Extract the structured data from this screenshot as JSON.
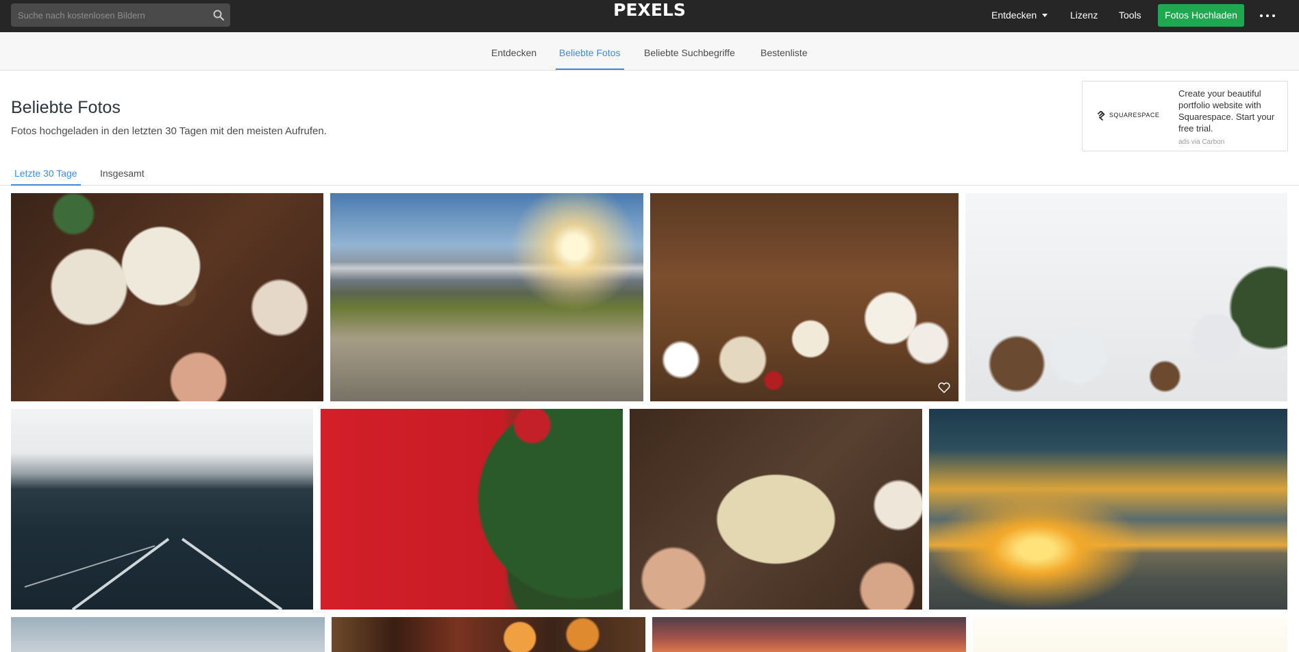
{
  "header": {
    "search_placeholder": "Suche nach kostenlosen Bildern",
    "search_icon": "search-icon",
    "logo": "PEXELS",
    "nav": {
      "discover": "Entdecken",
      "license": "Lizenz",
      "tools": "Tools",
      "upload": "Fotos Hochladen",
      "more_icon": "more-dots-icon"
    }
  },
  "subnav": {
    "items": [
      "Entdecken",
      "Beliebte Fotos",
      "Beliebte Suchbegriffe",
      "Bestenliste"
    ],
    "active": "Beliebte Fotos"
  },
  "page": {
    "title": "Beliebte Fotos",
    "subtitle": "Fotos hochgeladen in den letzten 30 Tagen mit den meisten Aufrufen."
  },
  "ad": {
    "brand": "SQUARESPACE",
    "text": "Create your beautiful portfolio website with Squarespace. Start your free trial.",
    "via": "ads via Carbon"
  },
  "tabs": {
    "items": [
      "Letzte 30 Tage",
      "Insgesamt"
    ],
    "active": "Letzte 30 Tage"
  },
  "colors": {
    "topbar": "#262626",
    "accent": "#3f8ad8",
    "upload": "#1fa84f"
  },
  "photos": [
    "christmas-gift-pinecones",
    "mountain-sunset",
    "wood-christmas-cookies",
    "white-wood-snowflakes-pinecones",
    "road-snowy-mountains",
    "red-background-christmas-wreath",
    "merry-christmas-card",
    "sunset-over-sea",
    "cloudy-sky",
    "christmas-lights-candles",
    "red-sunset-sky",
    "bright-light"
  ]
}
